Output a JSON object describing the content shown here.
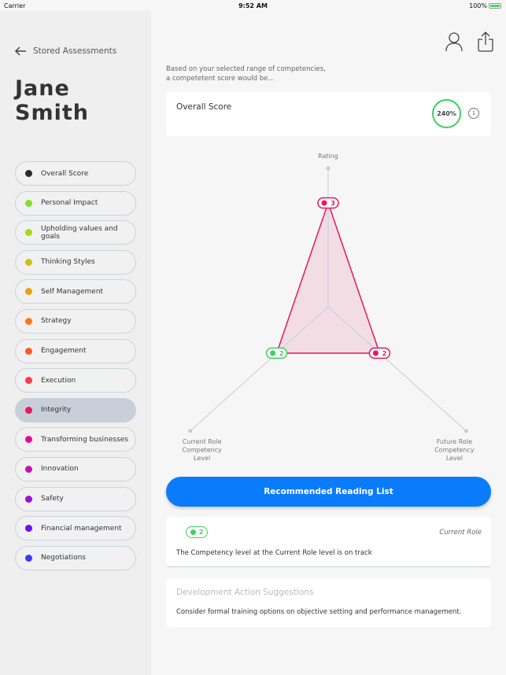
{
  "status": {
    "carrier": "Carrier",
    "time": "9:52 AM",
    "battery": "100%",
    "battery_level": 1.0
  },
  "nav": {
    "back_label": "Stored Assessments",
    "back_icon": "arrow-left-icon",
    "profile_icon": "person-icon",
    "share_icon": "share-icon"
  },
  "person": {
    "name": "Jane Smith"
  },
  "sidebar": {
    "items": [
      {
        "label": "Overall Score",
        "color": "#2b2b2b"
      },
      {
        "label": "Personal Impact",
        "color": "#7ee02a"
      },
      {
        "label": "Upholding values and goals",
        "color": "#a8d81a"
      },
      {
        "label": "Thinking Styles",
        "color": "#c9c21a"
      },
      {
        "label": "Self Management",
        "color": "#e8a012"
      },
      {
        "label": "Strategy",
        "color": "#fb7a16"
      },
      {
        "label": "Engagement",
        "color": "#fa5a2a"
      },
      {
        "label": "Execution",
        "color": "#fa3a48"
      },
      {
        "label": "Integrity",
        "color": "#ea1a5a",
        "selected": true
      },
      {
        "label": "Transforming businesses",
        "color": "#de108e"
      },
      {
        "label": "Innovation",
        "color": "#c012b2"
      },
      {
        "label": "Safety",
        "color": "#9a12d8"
      },
      {
        "label": "Financial management",
        "color": "#6a12f0"
      },
      {
        "label": "Negotiations",
        "color": "#3a3af8"
      }
    ]
  },
  "intro": {
    "line1": "Based on your selected range of competencies,",
    "line2": "a competetent score would be..."
  },
  "overall": {
    "label": "Overall Score",
    "value": "240%",
    "ring_color": "#3fcf5f",
    "info_icon": "info-icon",
    "info_glyph": "i"
  },
  "chart_data": {
    "type": "radar",
    "max": 4,
    "axes": [
      {
        "label": [
          "Rating"
        ],
        "value": 3,
        "label_display": "3",
        "marker_color": "#e8175d"
      },
      {
        "label": [
          "Current Role",
          "Competency",
          "Level"
        ],
        "value": 2,
        "label_display": "2",
        "marker_color": "#3fcf5f"
      },
      {
        "label": [
          "Future Role",
          "Competency",
          "Level"
        ],
        "value": 2,
        "label_display": "2",
        "marker_color": "#e8175d"
      }
    ],
    "series_color": "#e8175d",
    "fill_color": "#f2dde5"
  },
  "reading_button": "Recommended Reading List",
  "role_card": {
    "value": "2",
    "role": "Current Role",
    "message": "The Competency level at the Current Role level is on track"
  },
  "dev_card": {
    "title": "Development Action Suggestions",
    "message": "Consider formal training options on objective setting and performance management."
  }
}
